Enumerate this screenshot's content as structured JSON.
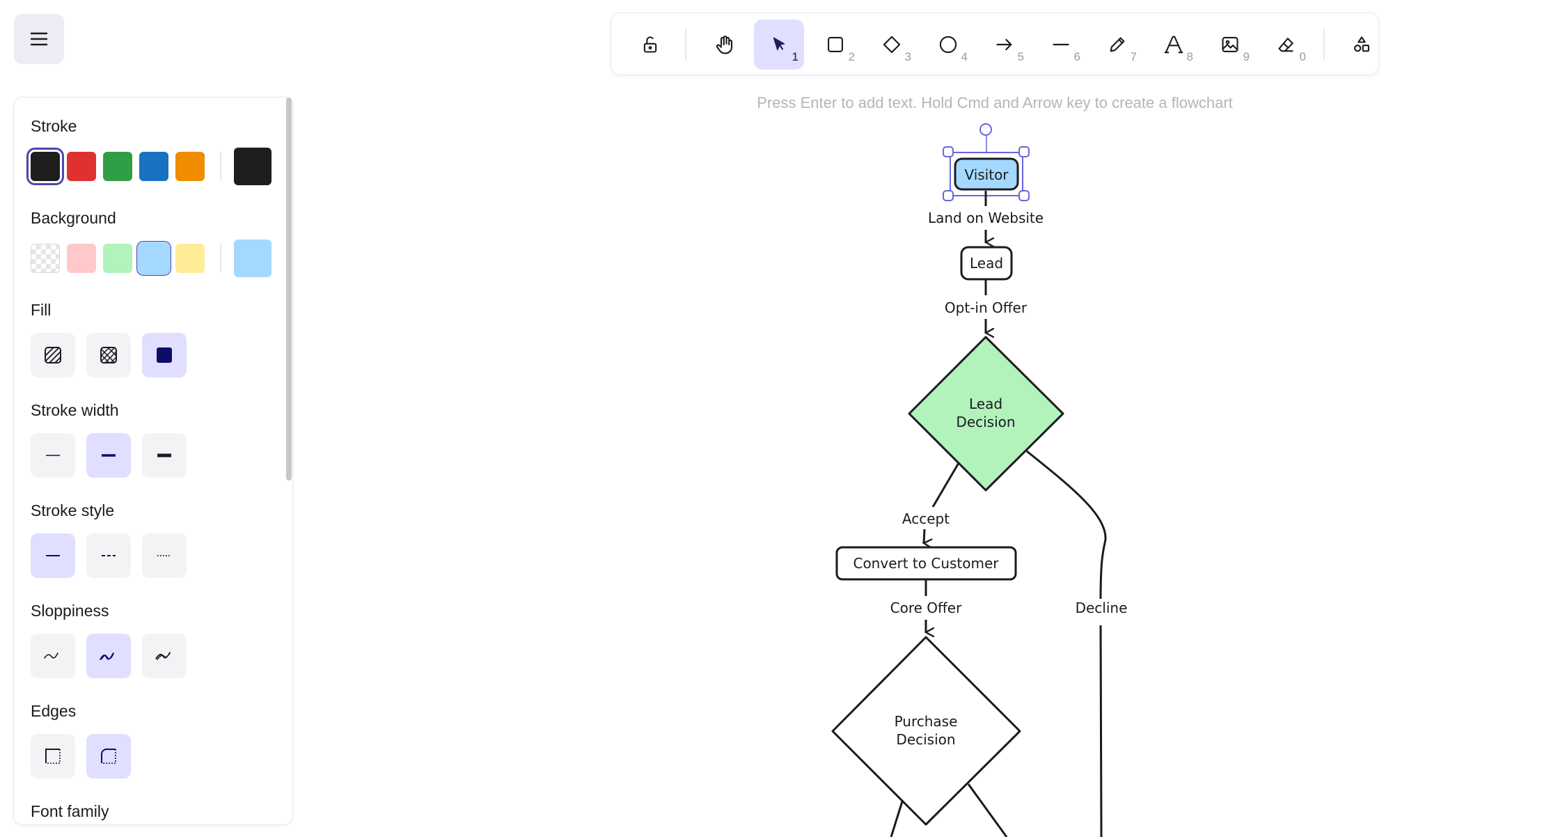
{
  "menu": {
    "icon": "hamburger-menu-icon"
  },
  "toolbar": {
    "tools": [
      {
        "name": "lock-icon",
        "key": ""
      },
      {
        "name": "hand-icon",
        "key": ""
      },
      {
        "name": "selection-icon",
        "key": "1",
        "active": true
      },
      {
        "name": "rectangle-icon",
        "key": "2"
      },
      {
        "name": "diamond-icon",
        "key": "3"
      },
      {
        "name": "ellipse-icon",
        "key": "4"
      },
      {
        "name": "arrow-icon",
        "key": "5"
      },
      {
        "name": "line-icon",
        "key": "6"
      },
      {
        "name": "pencil-icon",
        "key": "7"
      },
      {
        "name": "text-icon",
        "key": "8"
      },
      {
        "name": "image-icon",
        "key": "9"
      },
      {
        "name": "eraser-icon",
        "key": "0"
      },
      {
        "name": "extra-tools-icon",
        "key": ""
      }
    ]
  },
  "hint": "Press Enter to add text. Hold Cmd and Arrow key to create a flowchart",
  "panel": {
    "stroke_label": "Stroke",
    "stroke_colors": [
      "#1e1e1e",
      "#e03131",
      "#2f9e44",
      "#1971c2",
      "#f08c00"
    ],
    "stroke_current": "#1e1e1e",
    "background_label": "Background",
    "background_colors": [
      "transparent",
      "#ffc9c9",
      "#b2f2bb",
      "#a5d8ff",
      "#ffec99"
    ],
    "background_current": "#a5d8ff",
    "fill_label": "Fill",
    "stroke_width_label": "Stroke width",
    "stroke_style_label": "Stroke style",
    "sloppiness_label": "Sloppiness",
    "edges_label": "Edges",
    "font_family_label": "Font family"
  },
  "diagram": {
    "nodes": {
      "visitor": "Visitor",
      "lead": "Lead",
      "lead_decision_1": "Lead",
      "lead_decision_2": "Decision",
      "convert": "Convert to Customer",
      "purchase_1": "Purchase",
      "purchase_2": "Decision"
    },
    "edges": {
      "land": "Land on Website",
      "optin": "Opt-in Offer",
      "accept": "Accept",
      "decline": "Decline",
      "core": "Core Offer"
    },
    "colors": {
      "visitor_fill": "#a5d8ff",
      "decision_fill": "#b2f2bb",
      "selection": "#6965db"
    }
  }
}
